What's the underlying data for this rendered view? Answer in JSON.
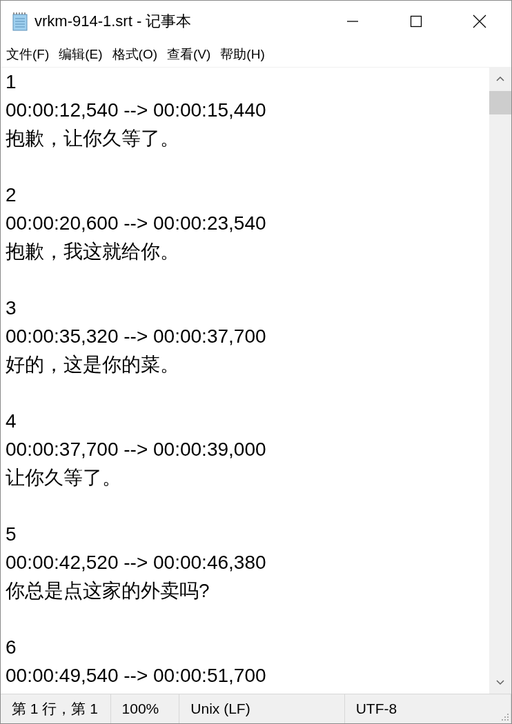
{
  "window": {
    "title": "vrkm-914-1.srt - 记事本"
  },
  "menu": [
    "文件(F)",
    "编辑(E)",
    "格式(O)",
    "查看(V)",
    "帮助(H)"
  ],
  "subtitles": [
    {
      "index": "1",
      "time": "00:00:12,540 --> 00:00:15,440",
      "text": "抱歉，让你久等了。"
    },
    {
      "index": "2",
      "time": "00:00:20,600 --> 00:00:23,540",
      "text": "抱歉，我这就给你。"
    },
    {
      "index": "3",
      "time": "00:00:35,320 --> 00:00:37,700",
      "text": "好的，这是你的菜。"
    },
    {
      "index": "4",
      "time": "00:00:37,700 --> 00:00:39,000",
      "text": "让你久等了。"
    },
    {
      "index": "5",
      "time": "00:00:42,520 --> 00:00:46,380",
      "text": "你总是点这家的外卖吗?"
    },
    {
      "index": "6",
      "time": "00:00:49,540 --> 00:00:51,700"
    }
  ],
  "status_bar": [
    "第 1 行，第 1",
    "100%",
    "Unix (LF)",
    "UTF-8"
  ]
}
